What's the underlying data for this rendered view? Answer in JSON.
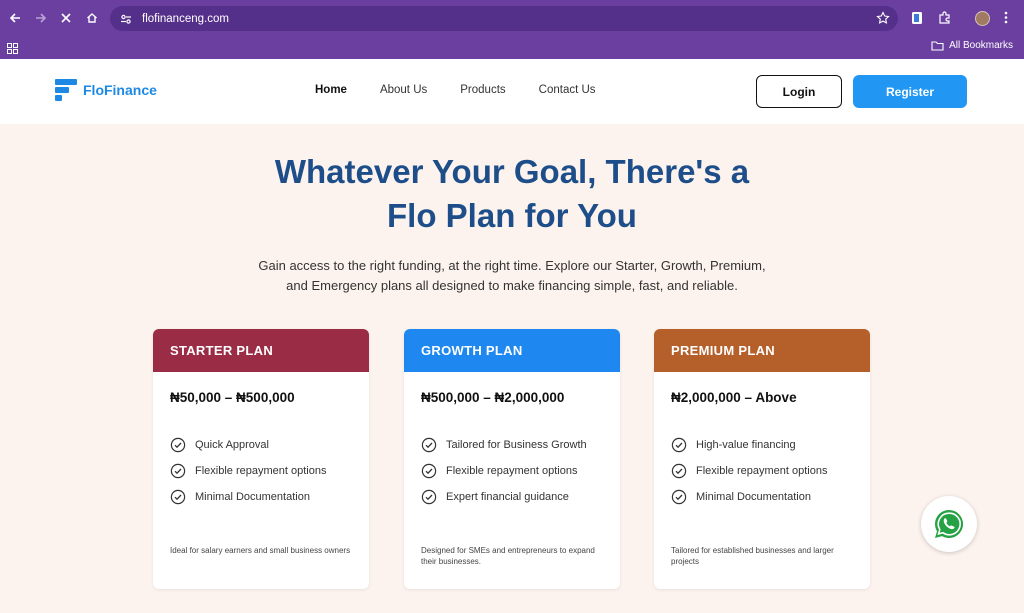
{
  "browser": {
    "url": "flofinanceng.com",
    "bookmarks_label": "All Bookmarks"
  },
  "header": {
    "logo_text": "FloFinance",
    "nav": [
      "Home",
      "About Us",
      "Products",
      "Contact Us"
    ],
    "login_label": "Login",
    "register_label": "Register"
  },
  "hero": {
    "title_line1": "Whatever Your Goal, There's a",
    "title_line2": "Flo Plan for You",
    "subtitle_line1": "Gain access to the right funding, at the right time. Explore our Starter, Growth, Premium,",
    "subtitle_line2": "and Emergency plans all designed to make financing simple, fast, and reliable."
  },
  "plans": [
    {
      "name": "STARTER PLAN",
      "color": "#9b2c45",
      "price": "₦50,000 – ₦500,000",
      "features": [
        "Quick Approval",
        "Flexible repayment options",
        "Minimal Documentation"
      ],
      "note": "Ideal for salary earners and small business owners"
    },
    {
      "name": "GROWTH PLAN",
      "color": "#1e88f0",
      "price": "₦500,000 – ₦2,000,000",
      "features": [
        "Tailored for Business Growth",
        "Flexible repayment options",
        "Expert financial guidance"
      ],
      "note": "Designed for SMEs and entrepreneurs to expand their businesses."
    },
    {
      "name": "PREMIUM PLAN",
      "color": "#b5602a",
      "price": "₦2,000,000 – Above",
      "features": [
        "High-value financing",
        "Flexible repayment options",
        "Minimal Documentation"
      ],
      "note": "Tailored for established businesses and larger projects"
    }
  ],
  "colors": {
    "brand_blue": "#1e88e5",
    "title_navy": "#1d4e89",
    "page_bg": "#fdf3ee",
    "chrome_purple": "#6b3fa0",
    "whatsapp_green": "#25a244"
  },
  "icons": {
    "whatsapp": "whatsapp-icon",
    "check": "check-circle-icon"
  }
}
